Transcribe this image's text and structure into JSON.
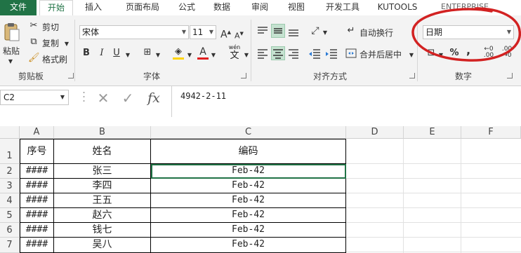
{
  "tabs": [
    "文件",
    "开始",
    "插入",
    "页面布局",
    "公式",
    "数据",
    "审阅",
    "视图",
    "开发工具",
    "KUTOOLS",
    "ENTERPRISE"
  ],
  "clipboard": {
    "paste": "粘贴",
    "cut": "剪切",
    "copy": "复制",
    "format_painter": "格式刷",
    "group_label": "剪贴板"
  },
  "font": {
    "name": "宋体",
    "size": "11",
    "grow": "A",
    "shrink": "A",
    "bold": "B",
    "italic": "I",
    "underline": "U",
    "font_color_glyph": "A",
    "wen": "wén",
    "wen_char": "文",
    "group_label": "字体"
  },
  "alignment": {
    "wrap_text": "自动换行",
    "merge_center": "合并后居中",
    "group_label": "对齐方式"
  },
  "number": {
    "format": "日期",
    "percent": "%",
    "comma": ",",
    "group_label": "数字"
  },
  "formula_bar": {
    "name_box": "C2",
    "cancel": "✕",
    "enter": "✓",
    "fx": "fx",
    "content": "4942-2-11"
  },
  "columns": [
    "A",
    "B",
    "C",
    "D",
    "E",
    "F"
  ],
  "rows": [
    {
      "num": "1",
      "a": "序号",
      "b": "姓名",
      "c": "编码"
    },
    {
      "num": "2",
      "a": "####",
      "b": "张三",
      "c": "Feb-42"
    },
    {
      "num": "3",
      "a": "####",
      "b": "李四",
      "c": "Feb-42"
    },
    {
      "num": "4",
      "a": "####",
      "b": "王五",
      "c": "Feb-42"
    },
    {
      "num": "5",
      "a": "####",
      "b": "赵六",
      "c": "Feb-42"
    },
    {
      "num": "6",
      "a": "####",
      "b": "钱七",
      "c": "Feb-42"
    },
    {
      "num": "7",
      "a": "####",
      "b": "吴八",
      "c": "Feb-42"
    }
  ],
  "colors": {
    "accent": "#217346",
    "annotation": "#d22222",
    "highlight": "#c5e2d0"
  }
}
